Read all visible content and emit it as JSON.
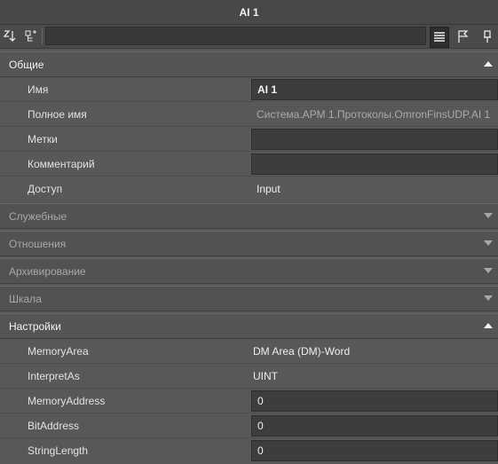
{
  "window": {
    "title": "AI 1"
  },
  "toolbar": {
    "sort_icon": "sort-az-icon",
    "expand_icon": "tree-expand-icon",
    "search_value": "",
    "list_icon": "list-view-icon",
    "flag_icon": "flag-icon",
    "pin_icon": "pin-icon"
  },
  "sections": {
    "general": {
      "title": "Общие",
      "expanded": true,
      "rows": {
        "name": {
          "label": "Имя",
          "value": "AI 1"
        },
        "full_name": {
          "label": "Полное имя",
          "value": "Система.АРМ 1.Протоколы.OmronFinsUDP.AI 1"
        },
        "tags": {
          "label": "Метки",
          "value": ""
        },
        "comment": {
          "label": "Комментарий",
          "value": ""
        },
        "access": {
          "label": "Доступ",
          "value": "Input"
        }
      }
    },
    "service": {
      "title": "Служебные",
      "expanded": false
    },
    "relations": {
      "title": "Отношения",
      "expanded": false
    },
    "archiving": {
      "title": "Архивирование",
      "expanded": false
    },
    "scale": {
      "title": "Шкала",
      "expanded": false
    },
    "settings": {
      "title": "Настройки",
      "expanded": true,
      "rows": {
        "memory_area": {
          "label": "MemoryArea",
          "value": "DM Area (DM)-Word"
        },
        "interpret_as": {
          "label": "InterpretAs",
          "value": "UINT"
        },
        "memory_address": {
          "label": "MemoryAddress",
          "value": "0"
        },
        "bit_address": {
          "label": "BitAddress",
          "value": "0"
        },
        "string_length": {
          "label": "StringLength",
          "value": "0"
        }
      }
    }
  },
  "colors": {
    "background": "#5a5856",
    "title_bar": "#4a4846",
    "input_field": "#3f3d3c",
    "text": "#e6e6e6",
    "muted_text": "#a8a8a8"
  }
}
